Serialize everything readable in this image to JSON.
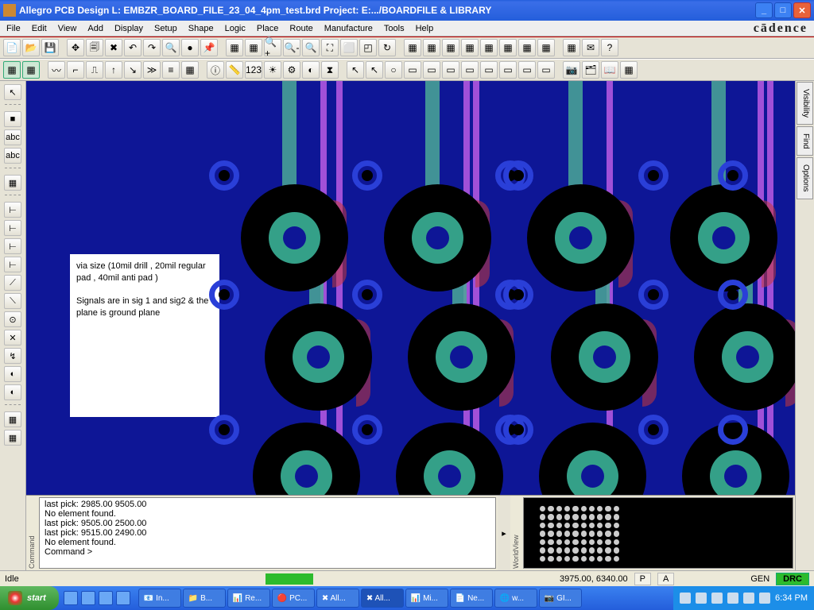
{
  "title": "Allegro PCB Design L: EMBZR_BOARD_FILE_23_04_4pm_test.brd  Project: E:.../BOARDFILE & LIBRARY",
  "menu": [
    "File",
    "Edit",
    "View",
    "Add",
    "Display",
    "Setup",
    "Shape",
    "Logic",
    "Place",
    "Route",
    "Manufacture",
    "Tools",
    "Help"
  ],
  "brand": "cādence",
  "right_tabs": [
    "Visibility",
    "Find",
    "Options"
  ],
  "note_l1": "via size (10mil drill , 20mil regular pad , 40mil anti pad )",
  "note_l2": "Signals are in sig 1 and sig2 & the plane is ground plane",
  "cmd": {
    "l1": "last pick:  2985.00  9505.00",
    "l2": "No element found.",
    "l3": "last pick:  9505.00  2500.00",
    "l4": "last pick:  9515.00  2490.00",
    "l5": "No element found.",
    "l6": "Command >"
  },
  "cmd_label": "Command",
  "wv_label": "WorldView",
  "status": {
    "idle": "Idle",
    "coords": "3975.00, 6340.00",
    "p": "P",
    "a": "A",
    "gen": "GEN",
    "drc": "DRC"
  },
  "taskbar": {
    "start": "start",
    "tasks": [
      "📧 In...",
      "📁 B...",
      "📊 Re...",
      "🔴 PC...",
      "✖ All...",
      "✖ All...",
      "📊 Mi...",
      "📄 Ne...",
      "🌐 w...",
      "📷 GI..."
    ],
    "clock": "6:34 PM"
  },
  "tb_icons": {
    "r1": [
      "📄",
      "📂",
      "💾",
      "✥",
      "🗐",
      "✖",
      "↶",
      "↷",
      "🔍",
      "●",
      "📌",
      "▦",
      "▦",
      "🔍+",
      "🔍-",
      "🔍",
      "⛶",
      "⬜",
      "◰",
      "↻",
      "▦",
      "▦",
      "▦",
      "▦",
      "▦",
      "▦",
      "▦",
      "▦",
      "▦",
      "✉",
      "?"
    ],
    "r2": [
      "▦",
      "▦",
      "〰",
      "⌐",
      "⎍",
      "↑",
      "↘",
      "≫",
      "≡",
      "▦",
      "ⓘ",
      "📏",
      "123",
      "☀",
      "⚙",
      "◐",
      "⧗",
      "↖",
      "↖",
      "○",
      "▭",
      "▭",
      "▭",
      "▭",
      "▭",
      "▭",
      "▭",
      "▭",
      "📷",
      "🗂",
      "📖",
      "▦"
    ]
  },
  "left_icons": [
    "↖",
    "■",
    "abc",
    "abc",
    "▦",
    "⊢",
    "⊢",
    "⊢",
    "⊢",
    "⟋",
    "⟍",
    "⊙",
    "✕",
    "↯",
    "◐",
    "◐",
    "▦",
    "▦"
  ]
}
